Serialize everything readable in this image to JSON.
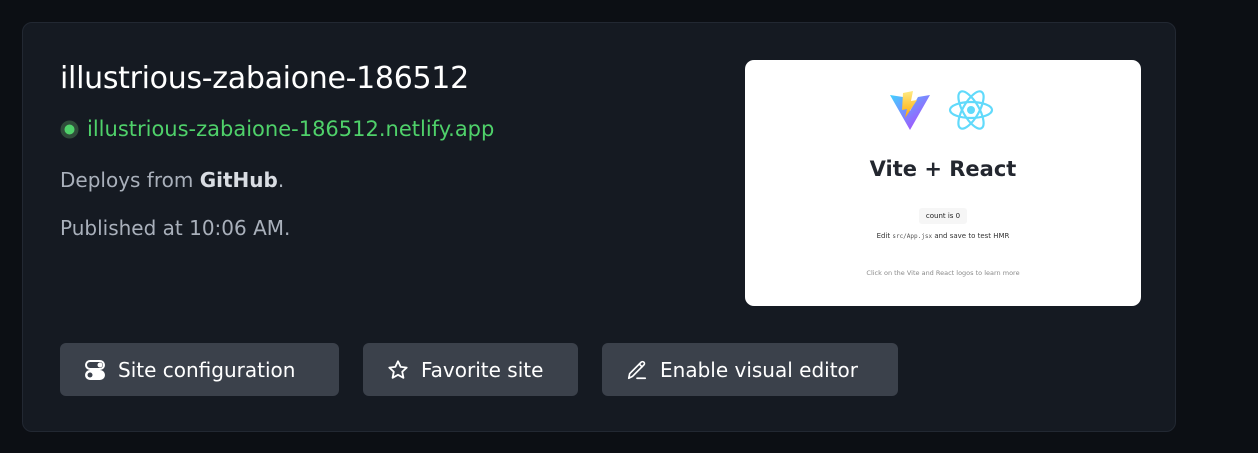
{
  "site": {
    "name": "illustrious-zabaione-186512",
    "url": "illustrious-zabaione-186512.netlify.app",
    "deploy_prefix": "Deploys from ",
    "deploy_source": "GitHub",
    "deploy_suffix": ".",
    "published": "Published at 10:06 AM.",
    "status_color": "#4fd16a"
  },
  "preview": {
    "title": "Vite + React",
    "count_button": "count is 0",
    "edit_prefix": "Edit ",
    "edit_code": "src/App.jsx",
    "edit_suffix": " and save to test HMR",
    "read_docs": "Click on the Vite and React logos to learn more",
    "logos": [
      "vite-logo",
      "react-logo"
    ]
  },
  "actions": {
    "site_configuration": "Site configuration",
    "favorite_site": "Favorite site",
    "enable_visual_editor": "Enable visual editor"
  },
  "icons": {
    "config": "toggles-icon",
    "favorite": "star-icon",
    "visual_editor": "pencil-icon"
  }
}
